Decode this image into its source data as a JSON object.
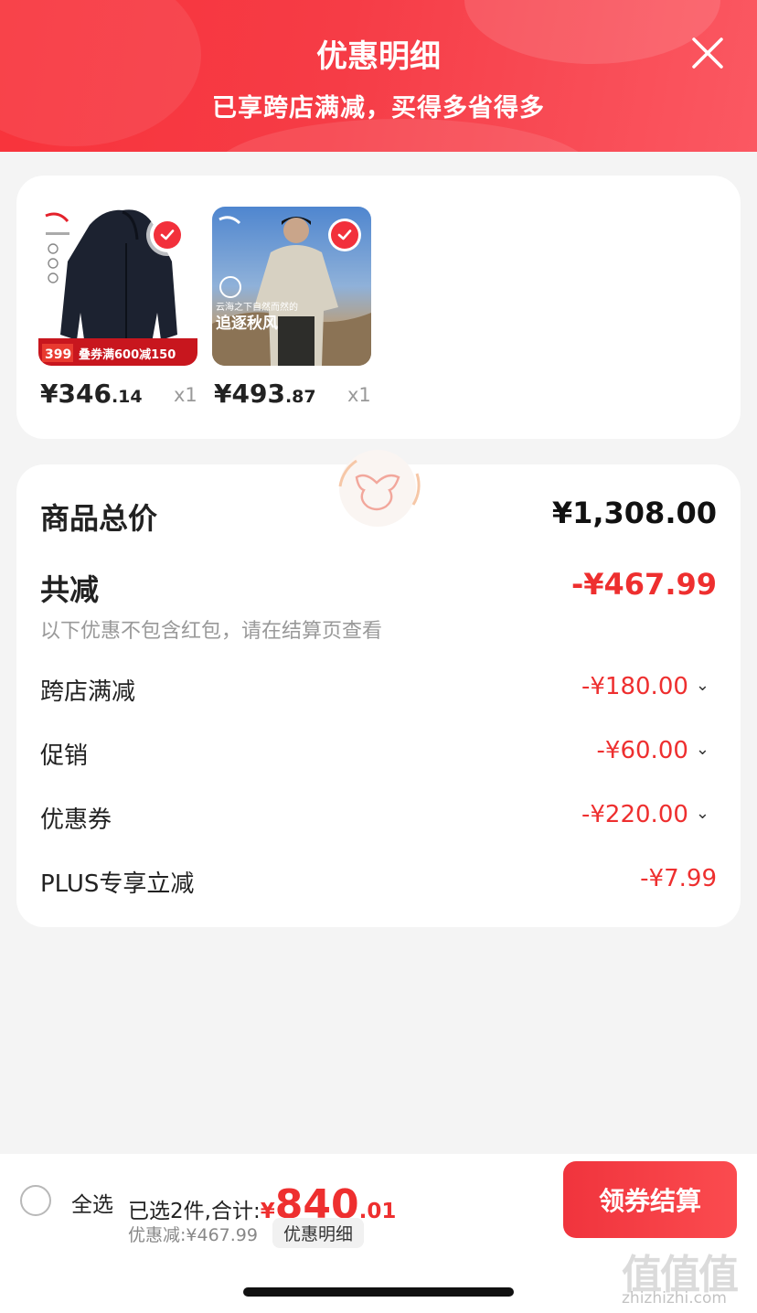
{
  "header": {
    "title": "优惠明细",
    "subtitle": "已享跨店满减，买得多省得多"
  },
  "products": [
    {
      "price_int": "¥346",
      "price_dec": ".14",
      "qty": "x1",
      "tag_price": "399",
      "tag_promo": "叠券满600减150"
    },
    {
      "price_int": "¥493",
      "price_dec": ".87",
      "qty": "x1",
      "img_text_1": "云海之下自然而然的",
      "img_text_2": "追逐秋风"
    }
  ],
  "summary": {
    "total_label": "商品总价",
    "total_value": "¥1,308.00",
    "reduce_label": "共减",
    "reduce_value": "-¥467.99",
    "note": "以下优惠不包含红包，请在结算页查看",
    "items": [
      {
        "label": "跨店满减",
        "value": "-¥180.00"
      },
      {
        "label": "促销",
        "value": "-¥60.00"
      },
      {
        "label": "优惠券",
        "value": "-¥220.00"
      },
      {
        "label": "PLUS专享立减",
        "value": "-¥7.99"
      }
    ]
  },
  "bottom": {
    "select_all": "全选",
    "selected_info": "已选2件,合计:",
    "total_yen": "¥",
    "total_int": "840",
    "total_dec": ".01",
    "discount": "优惠减:¥467.99",
    "detail_link": "优惠明细",
    "checkout": "领券结算"
  },
  "watermark": {
    "logo": "值值值",
    "url": "zhizhizhi.com"
  },
  "colors": {
    "accent": "#f63c46",
    "discount_red": "#ee2f2f"
  }
}
